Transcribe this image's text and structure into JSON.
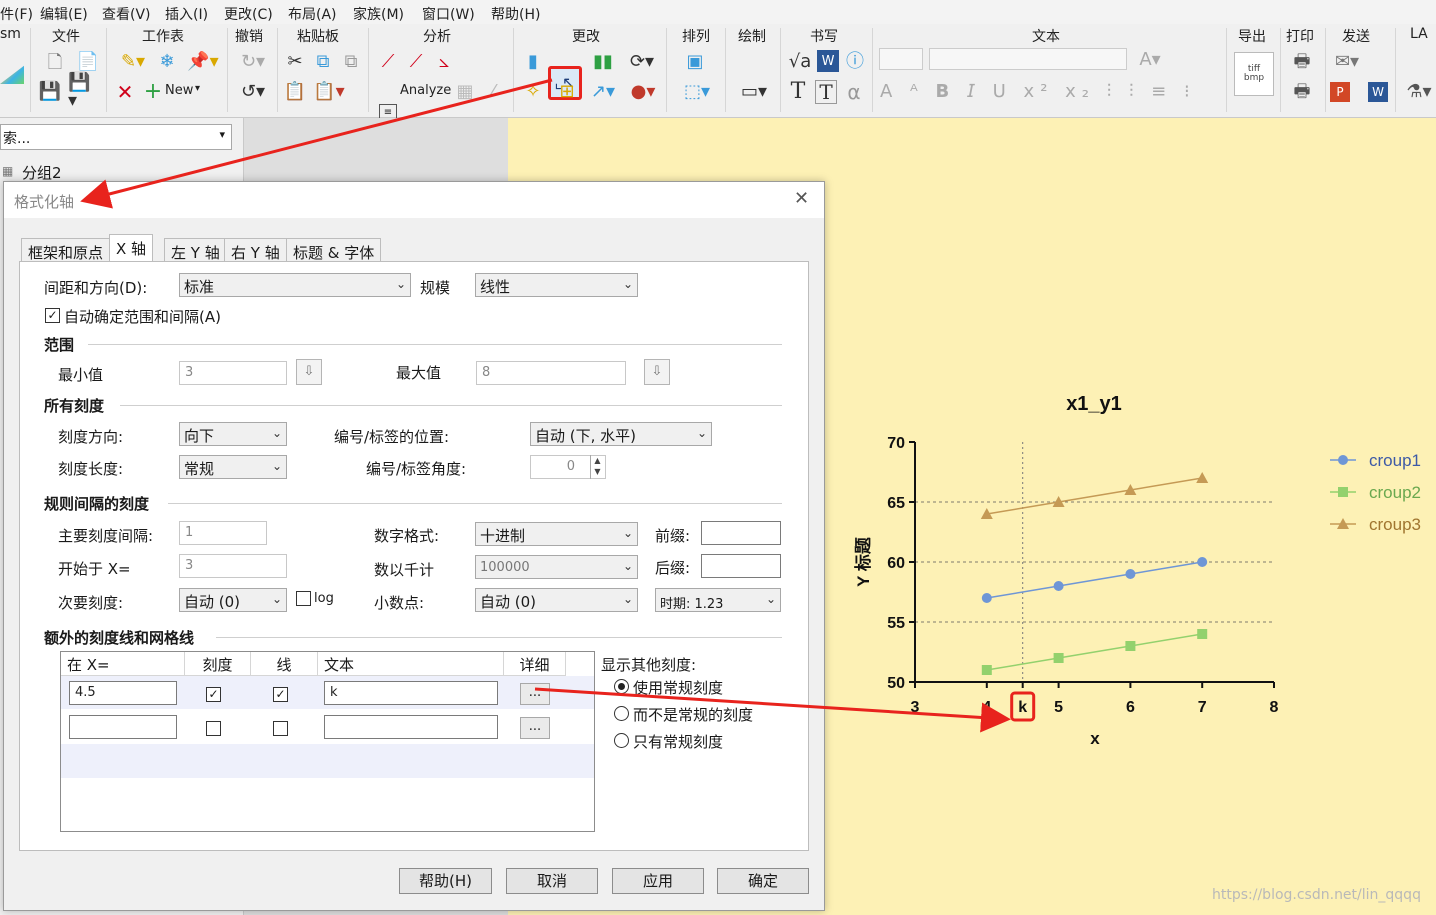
{
  "menu": [
    "件(F)",
    "编辑(E)",
    "查看(V)",
    "插入(I)",
    "更改(C)",
    "布局(A)",
    "家族(M)",
    "窗口(W)",
    "帮助(H)"
  ],
  "ribbon": {
    "groups": [
      "文件",
      "工作表",
      "撤销",
      "粘贴板",
      "分析",
      "更改",
      "排列",
      "绘制",
      "书写",
      "文本",
      "导出",
      "打印",
      "发送",
      "LA"
    ],
    "left_cut": "sm",
    "new_label": "New",
    "analyze_label": "Analyze",
    "export_icon_text": "tiff\nbmp"
  },
  "left_pane": {
    "search_text": "索...",
    "tree_item": "分组2"
  },
  "dialog": {
    "title": "格式化轴",
    "tabs": [
      "框架和原点",
      "X 轴",
      "左 Y 轴",
      "右 Y 轴",
      "标题 & 字体"
    ],
    "active_tab": 1,
    "spacing_label": "间距和方向(D):",
    "spacing_value": "标准",
    "scale_label": "规模",
    "scale_value": "线性",
    "auto_range_label": "自动确定范围和间隔(A)",
    "auto_range_checked": true,
    "range": {
      "header": "范围",
      "min_label": "最小值",
      "min_value": "3",
      "max_label": "最大值",
      "max_value": "8"
    },
    "all_ticks": {
      "header": "所有刻度",
      "direction_label": "刻度方向:",
      "direction_value": "向下",
      "length_label": "刻度长度:",
      "length_value": "常规",
      "label_pos_label": "编号/标签的位置:",
      "label_pos_value": "自动 (下, 水平)",
      "label_angle_label": "编号/标签角度:",
      "label_angle_value": "0"
    },
    "regular_ticks": {
      "header": "规则间隔的刻度",
      "major_label": "主要刻度间隔:",
      "major_value": "1",
      "start_label": "开始于 X=",
      "start_value": "3",
      "minor_label": "次要刻度:",
      "minor_value": "自动 (0)",
      "log_label": "log",
      "number_format_label": "数字格式:",
      "number_format_value": "十进制",
      "thousands_label": "数以千计",
      "thousands_value": "100000",
      "decimals_label": "小数点:",
      "decimals_value": "自动 (0)",
      "prefix_label": "前缀:",
      "suffix_label": "后缀:",
      "date_value": "时期: 1.23"
    },
    "extra": {
      "header": "额外的刻度线和网格线",
      "columns": [
        "在 X=",
        "刻度",
        "线",
        "文本",
        "详细"
      ],
      "rows": [
        {
          "x": "4.5",
          "tick": true,
          "line": true,
          "text": "k",
          "detail": "..."
        },
        {
          "x": "",
          "tick": false,
          "line": false,
          "text": "",
          "detail": "..."
        }
      ],
      "show_other_label": "显示其他刻度:",
      "options": [
        "使用常规刻度",
        "而不是常规的刻度",
        "只有常规刻度"
      ],
      "selected_option": 0
    },
    "buttons": {
      "help": "帮助(H)",
      "cancel": "取消",
      "apply": "应用",
      "ok": "确定"
    }
  },
  "colors": {
    "accent_red": "#e8231d",
    "chart_bg": "#fdf1b5",
    "series1": "#6e96d6",
    "series2": "#93d16d",
    "series3": "#c59a55"
  },
  "chart_data": {
    "type": "line",
    "title": "x1_y1",
    "xlabel": "x",
    "ylabel": "Y 标题",
    "xlim": [
      3,
      8
    ],
    "ylim": [
      50,
      70
    ],
    "xticks": [
      "3",
      "4",
      "k",
      "5",
      "6",
      "7",
      "8"
    ],
    "yticks": [
      "50",
      "55",
      "60",
      "65",
      "70"
    ],
    "extra_vline_x": 4.5,
    "extra_tick_label": "k",
    "grid": "horizontal dashed at 55, 60, 65",
    "legend_position": "right",
    "series": [
      {
        "name": "croup1",
        "marker": "circle",
        "x": [
          4,
          5,
          6,
          7
        ],
        "values": [
          57,
          58,
          59,
          60
        ]
      },
      {
        "name": "croup2",
        "marker": "square",
        "x": [
          4,
          5,
          6,
          7
        ],
        "values": [
          51,
          52,
          53,
          54
        ]
      },
      {
        "name": "croup3",
        "marker": "triangle",
        "x": [
          4,
          5,
          6,
          7
        ],
        "values": [
          64,
          65,
          66,
          67
        ]
      }
    ]
  },
  "watermark": "https://blog.csdn.net/lin_qqqq"
}
